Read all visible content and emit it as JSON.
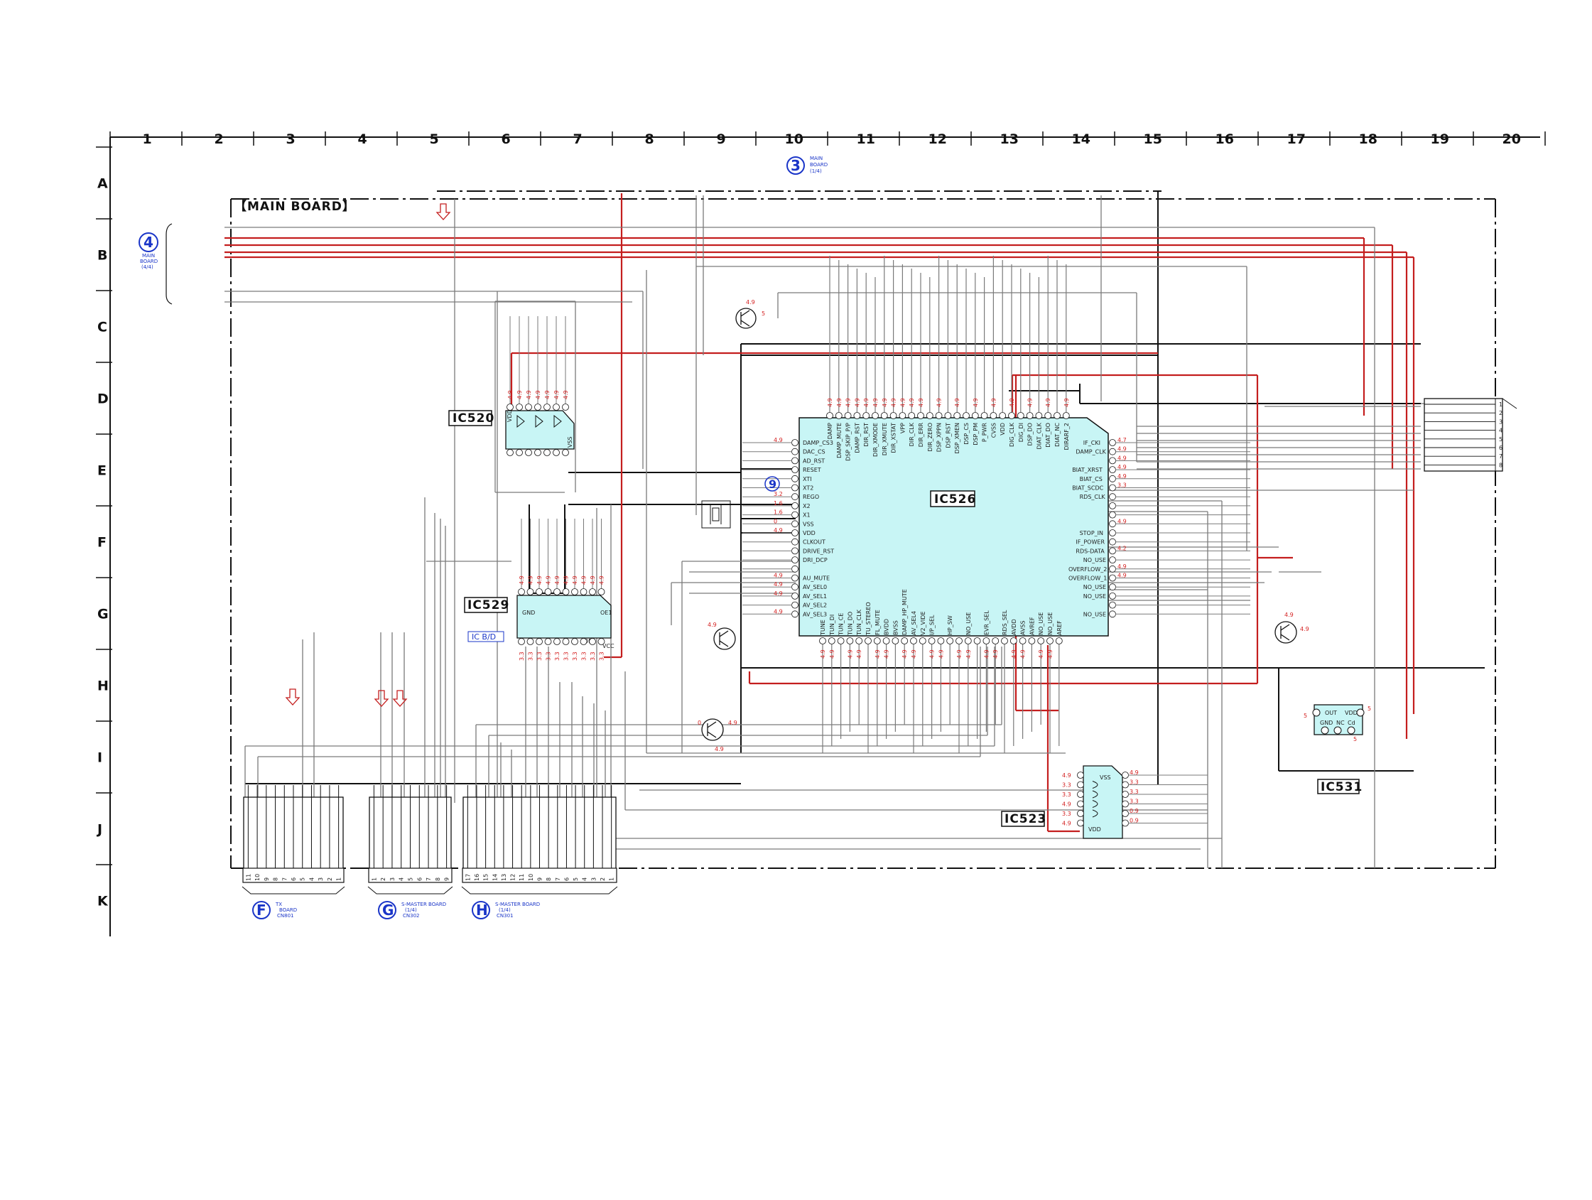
{
  "grid_columns": [
    "1",
    "2",
    "3",
    "4",
    "5",
    "6",
    "7",
    "8",
    "9",
    "10",
    "11",
    "12",
    "13",
    "14",
    "15",
    "16",
    "17",
    "18",
    "19",
    "20"
  ],
  "grid_rows": [
    "A",
    "B",
    "C",
    "D",
    "E",
    "F",
    "G",
    "H",
    "I",
    "J",
    "K"
  ],
  "board_title": "【MAIN BOARD】",
  "refs": {
    "main_3": {
      "num": "3",
      "line1": "MAIN",
      "line2": "BOARD",
      "line3": "(1/4)"
    },
    "main_4": {
      "num": "4",
      "line1": "MAIN",
      "line2": "BOARD",
      "line3": "(4/4)"
    },
    "marker_9": "9"
  },
  "ics": {
    "ic520": "IC520",
    "ic526": "IC526",
    "ic529": "IC529",
    "ic529_sub": "IC B/D",
    "ic523": "IC523",
    "ic531": "IC531"
  },
  "ic526_left_pins": [
    "DAMP_CS3",
    "DAC_CS",
    "AD_RST",
    "RESET",
    "XTI",
    "XT2",
    "REGO",
    "X2",
    "X1",
    "VSS",
    "VDD",
    "CLKOUT",
    "DRIVE_RST",
    "DRI_DCP",
    "",
    "AU_MUTE",
    "AV_SEL0",
    "AV_SEL1",
    "AV_SEL2",
    "AV_SEL3"
  ],
  "ic526_right_pins": [
    "IF_CKI",
    "DAMP_CLK",
    "",
    "BIAT_XRST",
    "BIAT_CS",
    "BIAT_SCDC",
    "RDS_CLK",
    "",
    "",
    "",
    "STOP_IN",
    "IF_POWER",
    "RDS-DATA",
    "NO_USE",
    "OVERFLOW_2",
    "OVERFLOW_1",
    "NO_USE",
    "NO_USE",
    "",
    "NO_USE"
  ],
  "ic526_top_pins": [
    "DAMP",
    "DAMP_MUTE",
    "DSP_SKIP_P/P",
    "DAMP_RST",
    "DIR_RST",
    "DIR_XMODE",
    "DIR_XMUTE",
    "DIR_XSTAT",
    "VPP",
    "DIR_CLK",
    "DIR_ERR",
    "DIR_ZERO",
    "DSP_XPPN",
    "DSP_RST",
    "DSP_XMEN",
    "DSP_CS",
    "DSP_PM",
    "P_PWR",
    "CVSS",
    "VDD",
    "DIG_CLK",
    "DIG_DI",
    "DSP_DO",
    "DIAT_CLK",
    "DIAT_DO",
    "DIAT_NC",
    "DIRARF_2"
  ],
  "ic526_bottom_pins": [
    "TUNE",
    "TUN_DI",
    "TUN_CE",
    "TUN_DO",
    "TUN_CLK",
    "TU_STEREO",
    "FL_MUTE",
    "BVDD",
    "BVSS",
    "DAMP_HP_MUTE",
    "AV_SEL4",
    "V2_VIDE",
    "I/P_SEL",
    "",
    "HP_SW",
    "",
    "NO_USE",
    "",
    "EVR_SEL",
    "",
    "RDS_SEL",
    "AVDD",
    "AVSS",
    "AVREF",
    "NO_USE",
    "NO_USE",
    "AREF"
  ],
  "ic531_pins": {
    "out": "OUT",
    "vdd": "VDD",
    "gnd": "GND",
    "nc": "NC",
    "cd": "Cd"
  },
  "ic523_pins": {
    "vss": "VSS",
    "vdd": "VDD"
  },
  "ic520_pins": {
    "vdd": "VDD",
    "vss": "VSS"
  },
  "ic529_pins": {
    "gnd": "GND",
    "vcc": "VCC",
    "oe1": "OE1",
    "oe2": "OE2"
  },
  "voltages_left": [
    "4.9",
    "",
    "",
    "",
    "",
    "",
    "3.2",
    "1.6",
    "1.6",
    "0",
    "4.9",
    "",
    "",
    "",
    "",
    "4.9",
    "4.9",
    "4.9",
    "",
    "4.9"
  ],
  "voltages_right": [
    "4.7",
    "4.9",
    "4.9",
    "4.9",
    "4.9",
    "3.3",
    "",
    "",
    "",
    "4.9",
    "",
    "",
    "4.2",
    "",
    "4.9",
    "4.9",
    "",
    "",
    "",
    ""
  ],
  "voltages_ic523_left": [
    "4.9",
    "3.3",
    "3.3",
    "4.9",
    "3.3",
    "4.9"
  ],
  "voltages_ic523_right": [
    "4.9",
    "3.3",
    "3.3",
    "3.3",
    "0.9",
    "0.9"
  ],
  "transistor_voltages": {
    "t1": "4.9",
    "t1b": "5",
    "t2": "4.9",
    "t3a": "0",
    "t3b": "4.9",
    "t3c": "4.9",
    "t4": "4.9",
    "t5": "4.9",
    "ic531_a": "5",
    "ic531_b": "5",
    "ic531_c": "5"
  },
  "connectors": [
    {
      "id": "F",
      "line1": "TX",
      "line2": "BOARD",
      "line3": "CN801",
      "pins": [
        "11",
        "10",
        "9",
        "8",
        "7",
        "6",
        "5",
        "4",
        "3",
        "2",
        "1"
      ]
    },
    {
      "id": "G",
      "line1": "S-MASTER BOARD",
      "line2": "(1/4)",
      "line3": "CN302",
      "pins": [
        "1",
        "2",
        "3",
        "4",
        "5",
        "6",
        "7",
        "8",
        "9"
      ]
    },
    {
      "id": "H",
      "line1": "S-MASTER BOARD",
      "line2": "(1/4)",
      "line3": "CN301",
      "pins": [
        "17",
        "16",
        "15",
        "14",
        "13",
        "12",
        "11",
        "10",
        "9",
        "8",
        "7",
        "6",
        "5",
        "4",
        "3",
        "2",
        "1"
      ]
    }
  ],
  "right_connector_pins": [
    "1",
    "2",
    "3",
    "4",
    "5",
    "6",
    "7",
    "8"
  ],
  "colors": {
    "trace_red": "#c41e1e",
    "trace_black": "#111111",
    "trace_gray": "#7a7a7a",
    "ic_fill": "#c8f5f5",
    "label_blue": "#1a35c8",
    "voltage_red": "#d42020"
  }
}
